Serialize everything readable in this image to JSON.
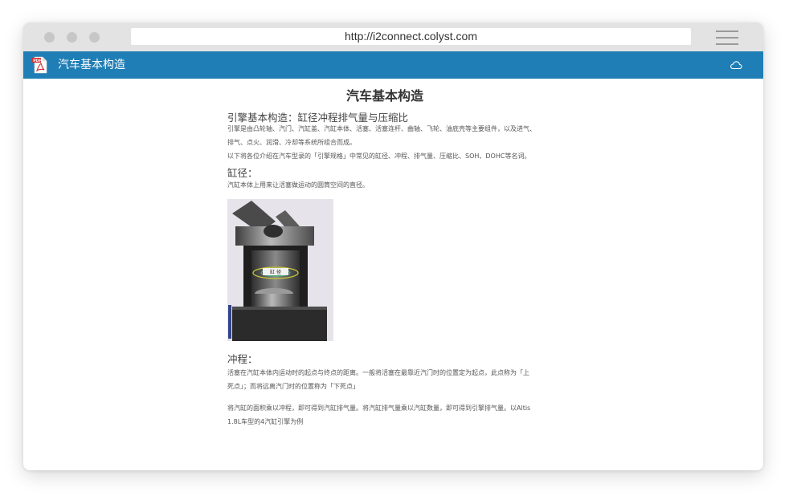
{
  "browser": {
    "url": "http://i2connect.colyst.com"
  },
  "appbar": {
    "title": "汽车基本构造"
  },
  "document": {
    "title": "汽车基本构造",
    "section_heading": "引擎基本构造：缸径冲程排气量与压缩比",
    "intro_p1_line1": "引擎是由凸轮轴、汽门、汽缸盖、汽缸本体、活塞、活塞连杆、曲轴、飞轮、油底壳等主要组件，以及进气、",
    "intro_p1_line2": "排气、点火、润滑、冷却等系统所组合而成。",
    "intro_p2": "以下将各位介绍在汽车型录的「引擎规格」中常见的缸径、冲程、排气量、压缩比、SOH、DOHC等名词。",
    "bore_heading": "缸径：",
    "bore_text": "汽缸本体上用来让活塞做运动的圆筒空间的直径。",
    "stroke_heading": "冲程：",
    "stroke_p1_line1": "活塞在汽缸本体内运动时的起点与终点的距离。一般将活塞在最靠近汽门时的位置定为起点，此点称为「上",
    "stroke_p1_line2": "死点」；而将远离汽门时的位置称为「下死点」",
    "stroke_p2_line1": "将汽缸的面积乘以冲程，即可得到汽缸排气量。将汽缸排气量乘以汽缸数量，即可得到引擎排气量。以Altis",
    "stroke_p2_line2": "1.8L车型的4汽缸引擎为例",
    "figure_label": "缸 径"
  },
  "colors": {
    "appbar": "#1f7eb5",
    "chrome": "#e3e3e3"
  },
  "icons": {
    "app": "pdf-icon",
    "sync": "cloud-icon",
    "menu": "hamburger-menu-icon"
  }
}
